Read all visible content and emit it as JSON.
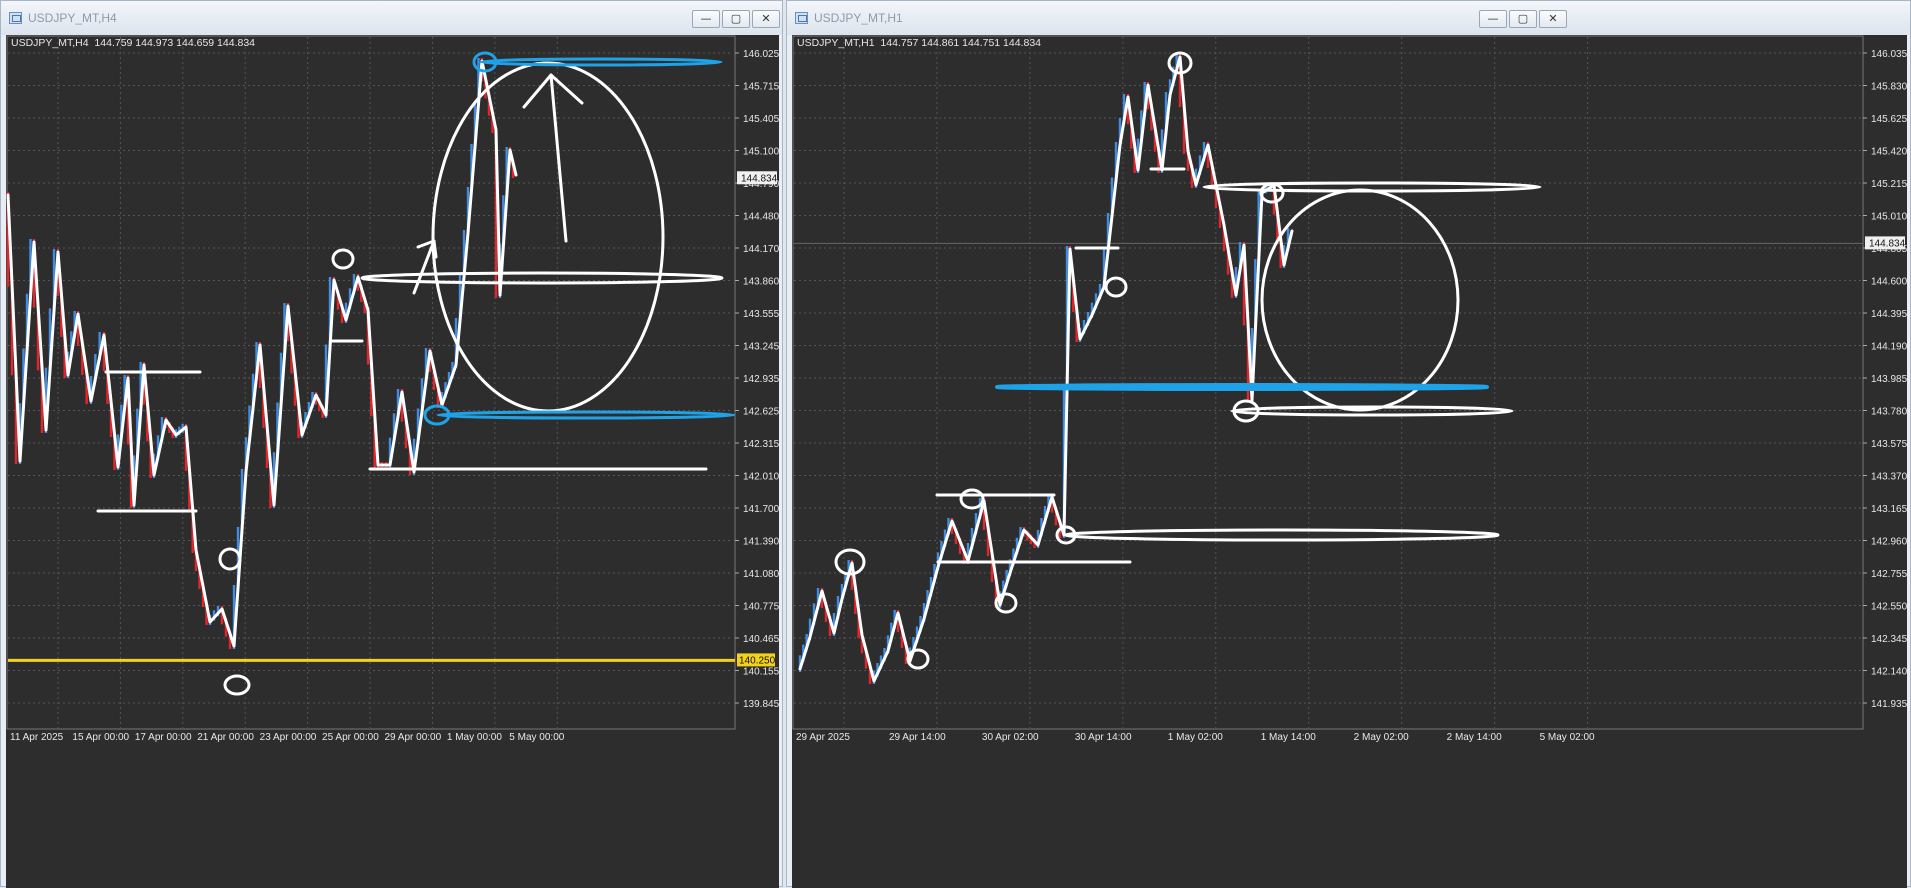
{
  "left_window": {
    "title": "USDJPY_MT,H4",
    "symbol_info": "USDJPY_MT,H4  144.759 144.973 144.659 144.834",
    "price_ticks": [
      "146.025",
      "145.715",
      "145.405",
      "145.100",
      "144.790",
      "144.480",
      "144.170",
      "143.860",
      "143.555",
      "143.245",
      "142.935",
      "142.625",
      "142.315",
      "142.010",
      "141.700",
      "141.390",
      "141.080",
      "140.775",
      "140.465",
      "140.155",
      "139.845"
    ],
    "time_ticks": [
      "11 Apr 2025",
      "15 Apr 00:00",
      "17 Apr 00:00",
      "21 Apr 00:00",
      "23 Apr 00:00",
      "25 Apr 00:00",
      "29 Apr 00:00",
      "1 May 00:00",
      "5 May 00:00"
    ],
    "current_price": "144.834",
    "hline_price": "140.250",
    "colors": {
      "bg": "#2d2d2d",
      "bull": "#3f8ee6",
      "bear": "#e8232a",
      "hline": "#f2d21b",
      "drawing": "#ffffff",
      "zone": "#1fa3e8"
    }
  },
  "right_window": {
    "title": "USDJPY_MT,H1",
    "symbol_info": "USDJPY_MT,H1  144.757 144.861 144.751 144.834",
    "price_ticks": [
      "146.035",
      "145.830",
      "145.625",
      "145.420",
      "145.215",
      "145.010",
      "144.805",
      "144.600",
      "144.395",
      "144.190",
      "143.985",
      "143.780",
      "143.575",
      "143.370",
      "143.165",
      "142.960",
      "142.755",
      "142.550",
      "142.345",
      "142.140",
      "141.935"
    ],
    "time_ticks": [
      "29 Apr 2025",
      "29 Apr 14:00",
      "30 Apr 02:00",
      "30 Apr 14:00",
      "1 May 02:00",
      "1 May 14:00",
      "2 May 02:00",
      "2 May 14:00",
      "5 May 02:00"
    ],
    "current_price": "144.834",
    "colors": {
      "bg": "#2d2d2d",
      "bull": "#3f8ee6",
      "bear": "#e8232a",
      "drawing": "#ffffff",
      "zone": "#1fa3e8"
    }
  },
  "window_buttons": {
    "minimize": "—",
    "maximize": "▢",
    "close": "✕"
  }
}
